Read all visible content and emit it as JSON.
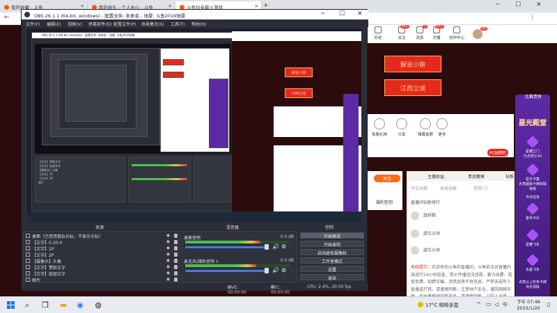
{
  "browser": {
    "tabs": [
      {
        "label": "我的收藏 - 斗鱼"
      },
      {
        "label": "我的收礼 - 个人中心 - 斗鱼"
      },
      {
        "label": "斗鱼抖音最火游戏"
      }
    ],
    "new_tab": "+",
    "header_items": [
      {
        "label": "历史",
        "badge": ""
      },
      {
        "label": "关注",
        "badge": "99+"
      },
      {
        "label": "消息",
        "badge": "1"
      },
      {
        "label": "开播",
        "badge": "99+"
      },
      {
        "label": "创作中心",
        "badge": ""
      }
    ],
    "avatar_badge": "16",
    "banner_buttons": [
      "解说小狼",
      "江西立诚"
    ],
    "room_tools": [
      "免费礼物",
      "分享",
      "弹幕投屏",
      "更多"
    ],
    "pcbang": "PCB网吧",
    "follow": "关注",
    "checkin": "福利签到",
    "rank_tabs": [
      "主播权益",
      "贵族徽章",
      "钻粉"
    ],
    "rank_subtabs": [
      "今日贡献",
      "本周贡献",
      "贵宾(7)"
    ],
    "rank_title": "直播间钻粉排行",
    "rank_rows": [
      "旋转鹤",
      "虚位以待",
      "虚位以待"
    ],
    "notice_title": "系统提示：",
    "notice_text": "欢迎来到斗鱼的直播间。斗鱼依法对直播内容进行24小时巡查，禁止传播违法违规、暴力血腥、低俗色情、招嫖诈骗、违禁品等不良信息，严禁未成年人直播或打赏。请谨慎判断，注意财产安全，谨防网络诈骗，如主播推销宣传产品，请谨慎判断，以防上当受骗。"
  },
  "promo": {
    "title": "比赛贵宾",
    "logo": "星光殿堂",
    "items": [
      "星耀之门",
      "已点亮1/10",
      "星光卡集",
      "点亮超级卡牌获取特效",
      "今日任务",
      "金币卡片",
      "星耀飞车",
      "水晶飞车",
      "点亮以上所有卡牌",
      "点击领取"
    ]
  },
  "obs": {
    "title": "OBS 26.1.1 (64-bit, windows) - 配置文件: 未命名 - 场景: 斗鱼2019场景",
    "menu": [
      "文件(F)",
      "编辑(E)",
      "视图(V)",
      "停靠部件(D)",
      "配置文件(P)",
      "场景集合(S)",
      "工具(T)",
      "帮助(H)"
    ],
    "dock_titles": {
      "sources": "来源",
      "mixer": "混音器",
      "controls": "控制"
    },
    "sources": [
      "桌面（已禁用鼠标光标，不显示光标）",
      "【文字】0-20-0",
      "【文字】1P",
      "【文字】2P",
      "【摄像头】头像",
      "【文字】赞助文字",
      "【文字】底部文字",
      "图片"
    ],
    "mixer": [
      {
        "name": "桌面音频",
        "db": "0.0 dB",
        "level": 0.72
      },
      {
        "name": "麦克风/辅助音频 1",
        "db": "0.0 dB",
        "level": 0.68
      }
    ],
    "controls": [
      "开始推流",
      "开始录制",
      "启动虚拟摄像机",
      "工作室模式",
      "设置",
      "退出"
    ],
    "status": {
      "live": "LIVE: 00:00:00",
      "rec": "REC: 00:00:00",
      "cpu": "CPU: 2.4%, 30.00 fps"
    },
    "preview_sources": [
      "【文字】赞助文字",
      "【文字】底部文字",
      "【摄像头】头像",
      "【文字】1P",
      "【文字】2P",
      "图片"
    ]
  },
  "taskbar": {
    "weather": "17°C 晴時多雲",
    "time": "下午 07:48",
    "date": "2022/1/20",
    "ime": "中"
  },
  "colors": {
    "obs_bg": "#2b2e38",
    "accent_red": "#e5291e",
    "promo_purple": "#5c2aa6"
  }
}
